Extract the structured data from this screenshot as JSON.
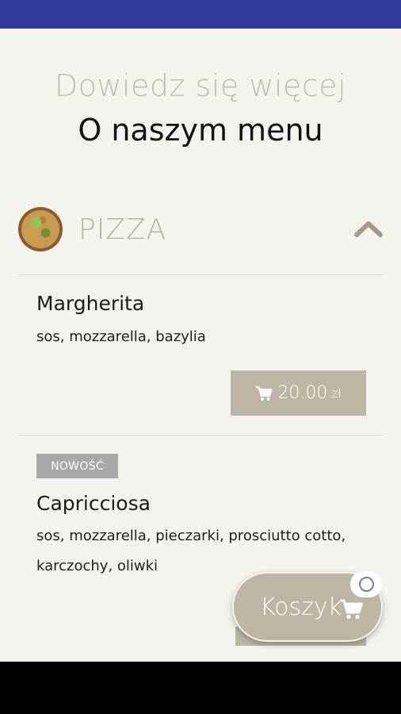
{
  "header": {
    "subtitle": "Dowiedz się więcej",
    "title": "O naszym menu"
  },
  "category": {
    "label": "PIZZA",
    "expanded": true,
    "toggle_icon": "chevron-up-icon"
  },
  "items": [
    {
      "name": "Margherita",
      "description": "sos, mozzarella, bazylia",
      "price": "20.00",
      "currency": "zł",
      "badge": ""
    },
    {
      "name": "Capricciosa",
      "description": "sos, mozzarella, pieczarki, prosciutto cotto, karczochy, oliwki",
      "badge": "NOWOŚĆ"
    }
  ],
  "cart": {
    "label": "Koszyk",
    "icon": "cart-icon"
  },
  "colors": {
    "status_bar": "#2e3a9c",
    "background": "#f4f4ee",
    "accent": "#bdb6a5",
    "badge": "#a8a8a8"
  }
}
